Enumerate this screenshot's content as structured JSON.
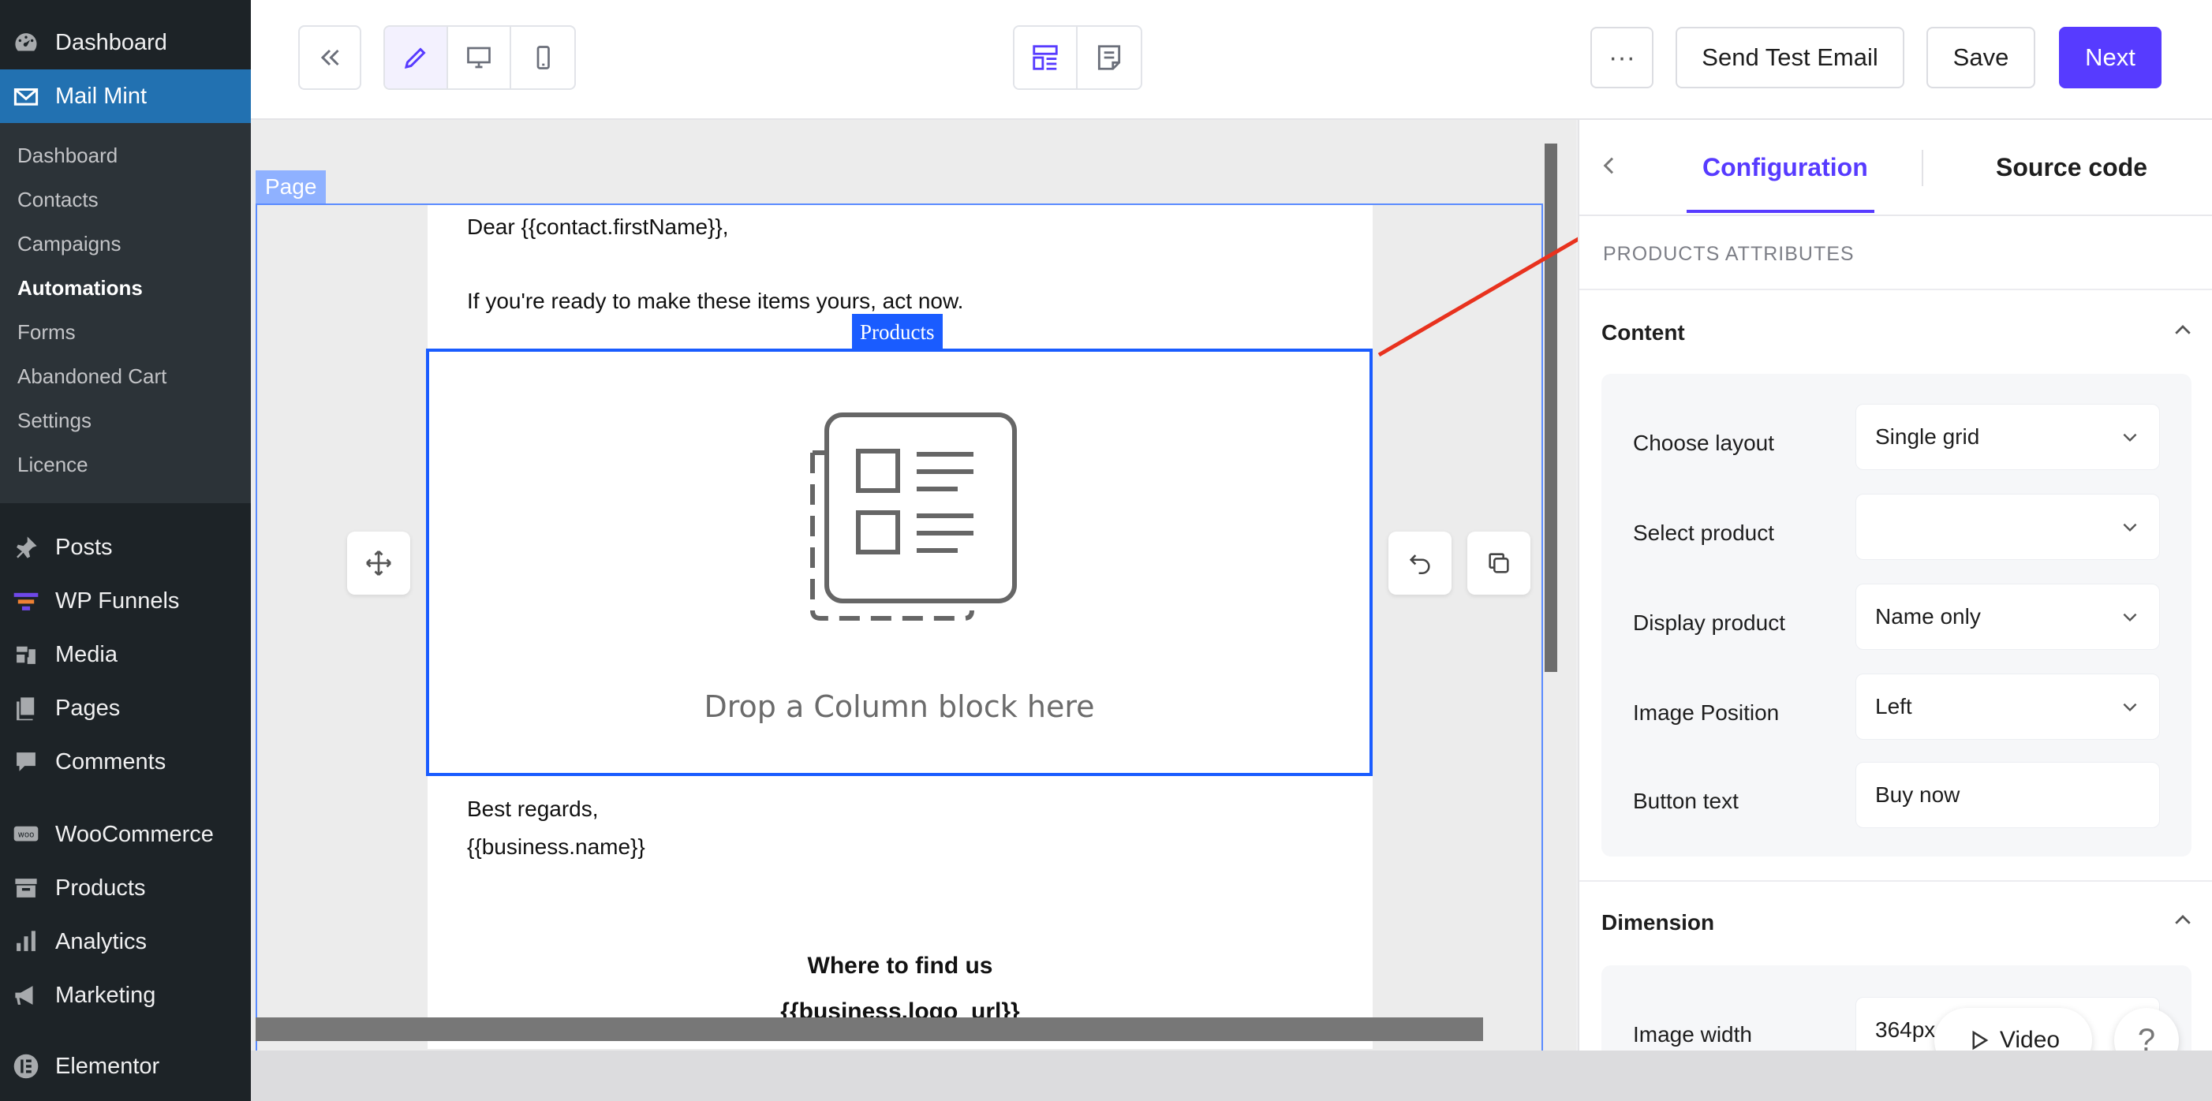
{
  "wp_menu": {
    "top": [
      {
        "label": "Dashboard",
        "icon": "dashboard-icon"
      },
      {
        "label": "Mail Mint",
        "icon": "mail-icon",
        "active": true
      }
    ],
    "submenu": [
      "Dashboard",
      "Contacts",
      "Campaigns",
      "Automations",
      "Forms",
      "Abandoned Cart",
      "Settings",
      "Licence"
    ],
    "submenu_current": "Automations",
    "bottom": [
      {
        "label": "Posts",
        "icon": "pin-icon"
      },
      {
        "label": "WP Funnels",
        "icon": "funnel-icon"
      },
      {
        "label": "Media",
        "icon": "media-icon"
      },
      {
        "label": "Pages",
        "icon": "pages-icon"
      },
      {
        "label": "Comments",
        "icon": "comment-icon"
      },
      {
        "label": "WooCommerce",
        "icon": "woo-icon"
      },
      {
        "label": "Products",
        "icon": "archive-icon"
      },
      {
        "label": "Analytics",
        "icon": "chart-bar-icon"
      },
      {
        "label": "Marketing",
        "icon": "megaphone-icon"
      },
      {
        "label": "Elementor",
        "icon": "elementor-icon"
      }
    ]
  },
  "toolbar": {
    "more_label": "···",
    "send_test_label": "Send Test Email",
    "save_label": "Save",
    "next_label": "Next"
  },
  "canvas": {
    "page_tag": "Page",
    "greeting": "Dear {{contact.firstName}},",
    "intro": "If you're ready to make these items yours, act now.",
    "products_tag": "Products",
    "drop_text": "Drop a Column block here",
    "closing": "Best regards,",
    "business_name": "{{business.name}}",
    "find_us": "Where to find us",
    "logo_url": "{{business.logo_url}}"
  },
  "panel": {
    "tab_config": "Configuration",
    "tab_source": "Source code",
    "section_title": "PRODUCTS ATTRIBUTES",
    "content_title": "Content",
    "rows": [
      {
        "label": "Choose layout",
        "value": "Single grid",
        "dropdown": true
      },
      {
        "label": "Select product",
        "value": "",
        "dropdown": true
      },
      {
        "label": "Display product",
        "value": "Name only",
        "dropdown": true
      },
      {
        "label": "Image Position",
        "value": "Left",
        "dropdown": true
      },
      {
        "label": "Button text",
        "value": "Buy now",
        "dropdown": false
      }
    ],
    "dimension_title": "Dimension",
    "dim_label": "Image width",
    "dim_value": "364px"
  },
  "video_label": "Video",
  "help_label": "?",
  "colors": {
    "accent": "#573bff",
    "wp_active": "#2271b1",
    "selection": "#1a5cff",
    "annotation_arrow": "#e8321e"
  }
}
